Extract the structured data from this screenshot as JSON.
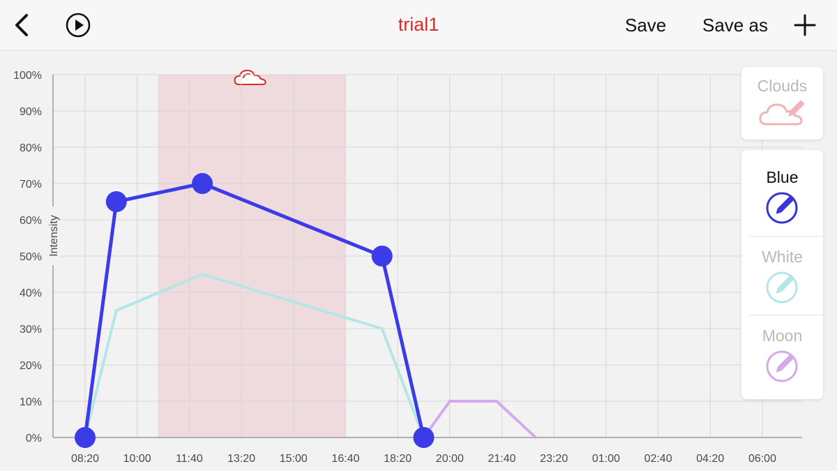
{
  "header": {
    "title": "trial1",
    "save_label": "Save",
    "save_as_label": "Save as",
    "back_icon": "chevron-left-icon",
    "play_icon": "play-circle-icon",
    "add_icon": "plus-icon"
  },
  "chart_data": {
    "type": "line",
    "ylabel": "Intensity",
    "ylim": [
      0,
      100
    ],
    "yticks": [
      "0%",
      "10%",
      "20%",
      "30%",
      "40%",
      "50%",
      "60%",
      "70%",
      "80%",
      "90%",
      "100%"
    ],
    "xticks": [
      "08:20",
      "10:00",
      "11:40",
      "13:20",
      "15:00",
      "16:40",
      "18:20",
      "20:00",
      "21:40",
      "23:20",
      "01:00",
      "02:40",
      "04:20",
      "06:00"
    ],
    "grid": true,
    "cloud_period": {
      "start": "10:40",
      "end": "16:40"
    },
    "series": [
      {
        "name": "Blue",
        "color": "#3b3be8",
        "points": [
          [
            "08:20",
            0
          ],
          [
            "09:20",
            65
          ],
          [
            "12:05",
            70
          ],
          [
            "17:50",
            50
          ],
          [
            "19:10",
            0
          ]
        ]
      },
      {
        "name": "White",
        "color": "#b4e6e6",
        "points": [
          [
            "08:20",
            0
          ],
          [
            "09:20",
            35
          ],
          [
            "12:05",
            45
          ],
          [
            "17:50",
            30
          ],
          [
            "19:10",
            0
          ]
        ]
      },
      {
        "name": "Moon",
        "color": "#d6a8ee",
        "points": [
          [
            "19:10",
            0
          ],
          [
            "20:00",
            10
          ],
          [
            "21:30",
            10
          ],
          [
            "22:45",
            0
          ]
        ]
      }
    ]
  },
  "panels": {
    "clouds": {
      "label": "Clouds",
      "icon": "cloud-edit-icon",
      "color": "#efb3b8"
    },
    "channels": [
      {
        "label": "Blue",
        "icon": "pencil-circle-icon",
        "color": "#3535d8",
        "active": true
      },
      {
        "label": "White",
        "icon": "pencil-circle-icon",
        "color": "#b4e6e6",
        "active": false
      },
      {
        "label": "Moon",
        "icon": "pencil-circle-icon",
        "color": "#d6a8ee",
        "active": false
      }
    ]
  }
}
